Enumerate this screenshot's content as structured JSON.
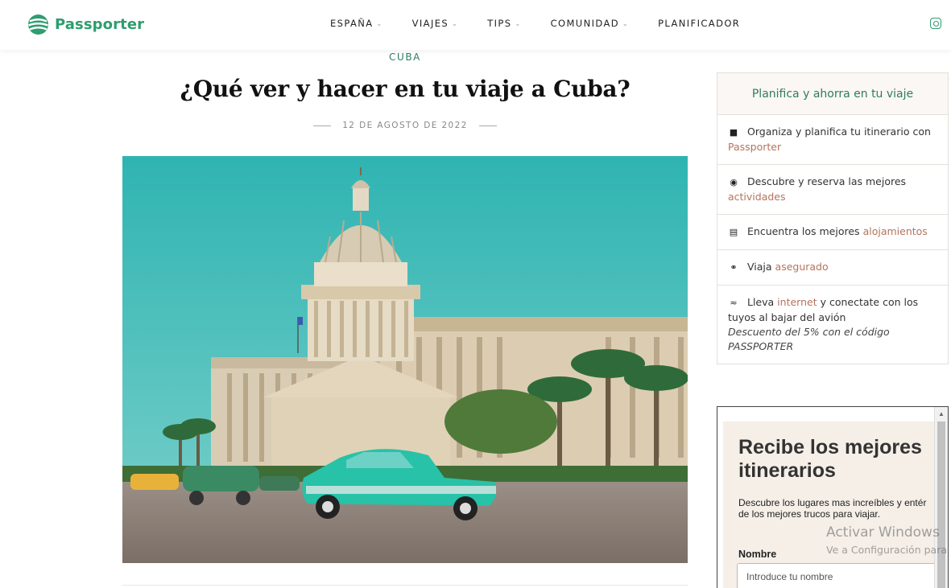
{
  "header": {
    "brand": "Passporter",
    "nav": [
      {
        "label": "ESPAÑA",
        "has_dropdown": true
      },
      {
        "label": "VIAJES",
        "has_dropdown": true
      },
      {
        "label": "TIPS",
        "has_dropdown": true
      },
      {
        "label": "COMUNIDAD",
        "has_dropdown": true
      },
      {
        "label": "PLANIFICADOR",
        "has_dropdown": false
      }
    ],
    "social_icon": "instagram-icon"
  },
  "article": {
    "category": "CUBA",
    "title": "¿Qué ver y hacer en tu viaje a Cuba?",
    "date": "12 DE AGOSTO DE 2022",
    "hero_subject": "capitolio-havana-classic-car"
  },
  "sidebar": {
    "widget_title": "Planifica y ahorra en tu viaje",
    "items": [
      {
        "icon": "map-icon",
        "text": "Organiza y planifica tu itinerario con",
        "link": "Passporter",
        "after": ""
      },
      {
        "icon": "binoculars-icon",
        "text": "Descubre y reserva las mejores",
        "link": "actividades",
        "after": ""
      },
      {
        "icon": "bed-icon",
        "text": "Encuentra los mejores",
        "link": "alojamientos",
        "after": ""
      },
      {
        "icon": "stethoscope-icon",
        "text": "Viaja",
        "link": "asegurado",
        "after": ""
      },
      {
        "icon": "wifi-icon",
        "text": "Lleva",
        "link": "internet",
        "after": "y conectate con los tuyos al bajar del avión",
        "note": "Descuento del 5% con el código PASSPORTER"
      }
    ]
  },
  "newsletter": {
    "title": "Recibe los mejores itinerarios",
    "description_line1": "Descubre los lugares mas increíbles y entér",
    "description_line2": "de los mejores trucos para viajar.",
    "name_label": "Nombre",
    "name_placeholder": "Introduce tu nombre"
  },
  "watermark": {
    "line1": "Activar Windows",
    "line2": "Ve a Configuración para"
  },
  "colors": {
    "brand_green": "#2e9d6f",
    "link": "#b5735c",
    "widget_bg": "#faf7f4",
    "newsletter_bg": "#f5efe8"
  }
}
